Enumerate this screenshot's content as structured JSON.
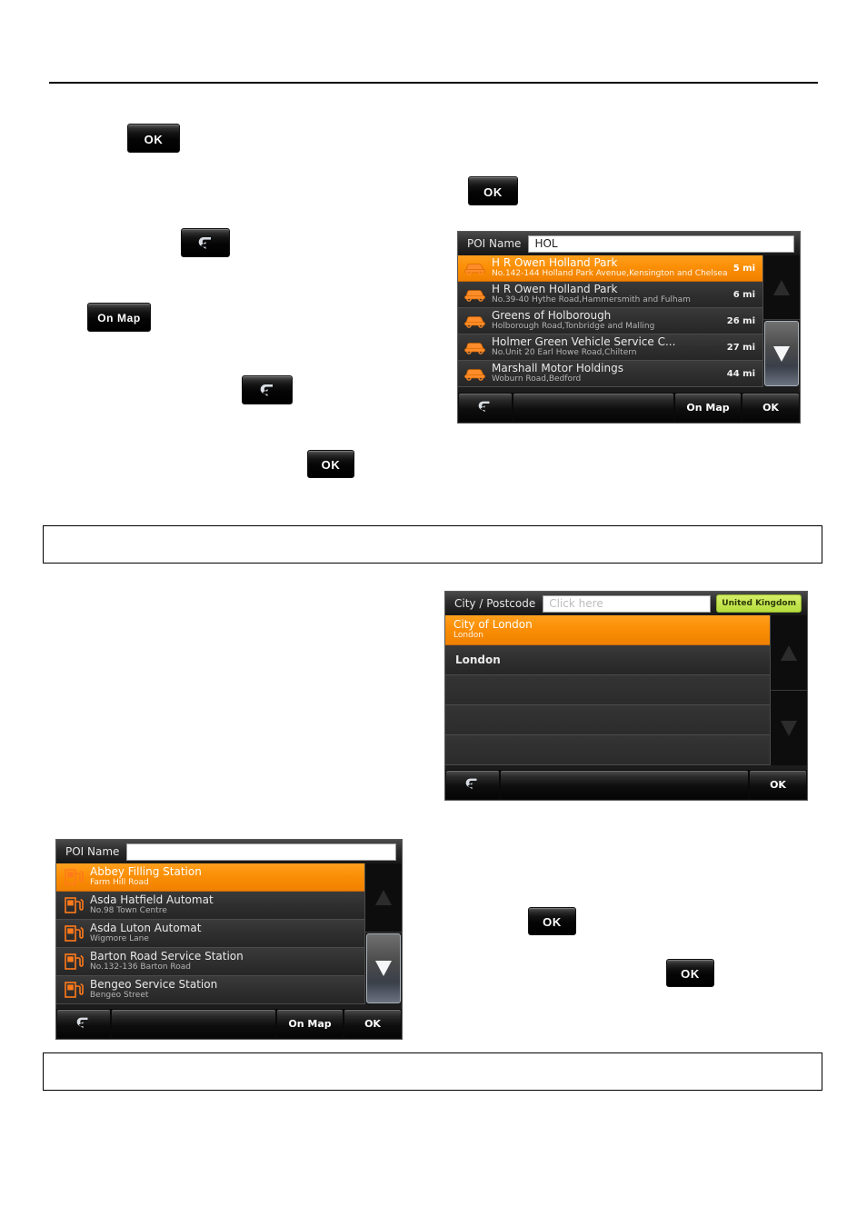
{
  "page": {
    "note_boxes": [
      "",
      ""
    ]
  },
  "buttons": {
    "ok_1": "OK",
    "ok_2": "OK",
    "ok_3": "OK",
    "ok_4": "OK",
    "ok_5": "OK",
    "back_1": "back-arrow-icon",
    "back_2": "back-arrow-icon",
    "on_map_1": "On Map"
  },
  "device_poi_hol": {
    "header_label": "POI Name",
    "input_value": "HOL",
    "rows": [
      {
        "title": "H R Owen Holland Park",
        "sub": "No.142-144 Holland Park Avenue,Kensington and Chelsea",
        "dist": "5 mi",
        "icon": "car-icon",
        "selected": true
      },
      {
        "title": "H R Owen Holland Park",
        "sub": "No.39-40 Hythe Road,Hammersmith and Fulham",
        "dist": "6 mi",
        "icon": "car-icon",
        "selected": false
      },
      {
        "title": "Greens of Holborough",
        "sub": "Holborough Road,Tonbridge and Malling",
        "dist": "26 mi",
        "icon": "car-icon",
        "selected": false
      },
      {
        "title": "Holmer Green Vehicle Service C...",
        "sub": "No.Unit 20 Earl Howe Road,Chiltern",
        "dist": "27 mi",
        "icon": "car-icon",
        "selected": false
      },
      {
        "title": "Marshall Motor Holdings",
        "sub": "Woburn Road,Bedford",
        "dist": "44 mi",
        "icon": "car-icon",
        "selected": false
      }
    ],
    "scroll": {
      "up": "scroll-up-arrow-icon",
      "down": "scroll-down-arrow-icon",
      "up_active": false,
      "down_active": true
    },
    "footer": {
      "back": "back-arrow-icon",
      "on_map": "On Map",
      "ok": "OK"
    }
  },
  "device_city": {
    "header_label": "City / Postcode",
    "input_placeholder": "Click here",
    "input_value": "",
    "country_badge": "United Kingdom",
    "rows": [
      {
        "title": "City of London",
        "sub": "London",
        "selected": true
      },
      {
        "title": "London",
        "sub": "",
        "selected": false,
        "plain": true
      },
      {
        "title": "",
        "sub": "",
        "selected": false,
        "empty": true
      },
      {
        "title": "",
        "sub": "",
        "selected": false,
        "empty": true
      },
      {
        "title": "",
        "sub": "",
        "selected": false,
        "empty": true
      }
    ],
    "scroll": {
      "up": "scroll-up-arrow-icon",
      "down": "scroll-down-arrow-icon",
      "up_active": false,
      "down_active": false
    },
    "footer": {
      "back": "back-arrow-icon",
      "ok": "OK"
    }
  },
  "device_poi_fuel": {
    "header_label": "POI Name",
    "input_value": "",
    "rows": [
      {
        "title": "Abbey Filling Station",
        "sub": "Farm Hill Road",
        "icon": "fuel-pump-icon",
        "selected": true
      },
      {
        "title": "Asda Hatfield Automat",
        "sub": "No.98 Town Centre",
        "icon": "fuel-pump-icon",
        "selected": false
      },
      {
        "title": "Asda Luton Automat",
        "sub": "Wigmore Lane",
        "icon": "fuel-pump-icon",
        "selected": false
      },
      {
        "title": "Barton Road Service Station",
        "sub": "No.132-136 Barton Road",
        "icon": "fuel-pump-icon",
        "selected": false
      },
      {
        "title": "Bengeo Service Station",
        "sub": "Bengeo Street",
        "icon": "fuel-pump-icon",
        "selected": false
      }
    ],
    "scroll": {
      "up": "scroll-up-arrow-icon",
      "down": "scroll-down-arrow-icon",
      "up_active": false,
      "down_active": true
    },
    "footer": {
      "back": "back-arrow-icon",
      "on_map": "On Map",
      "ok": "OK"
    }
  },
  "colors": {
    "selection_orange": "#f89406",
    "badge_green": "#c3e558",
    "panel_dark": "#2f2f2f",
    "text_light": "#e9e9e9"
  }
}
